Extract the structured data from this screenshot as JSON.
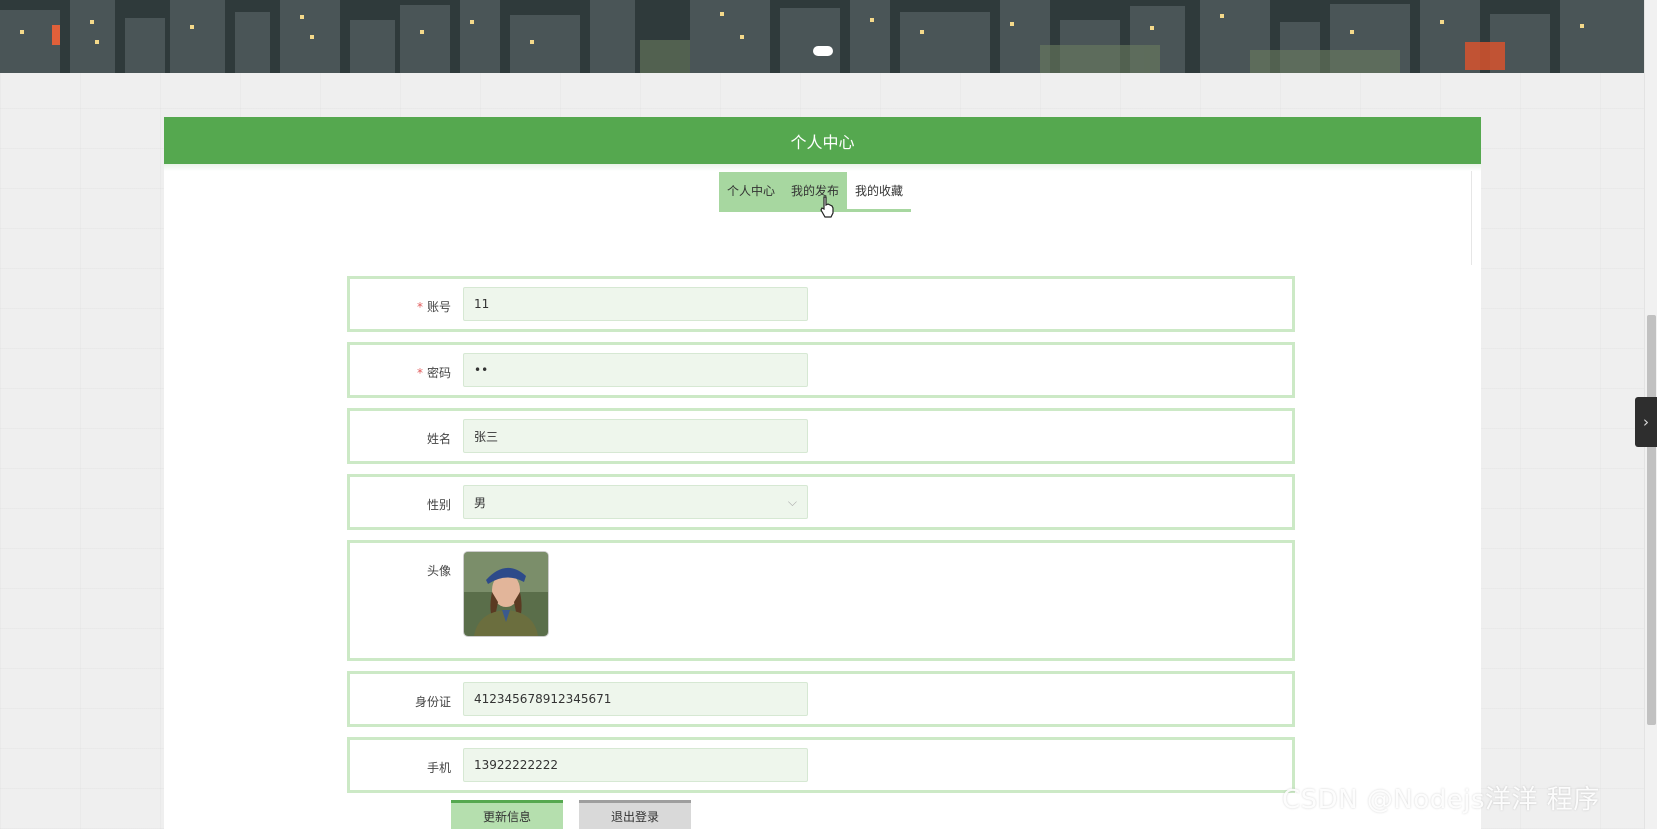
{
  "header": {
    "title": "个人中心"
  },
  "tabs": [
    {
      "label": "个人中心",
      "active": true
    },
    {
      "label": "我的发布",
      "active": false
    },
    {
      "label": "我的收藏",
      "active": false
    }
  ],
  "form": {
    "account": {
      "label": "账号",
      "value": "11",
      "required": true
    },
    "password": {
      "label": "密码",
      "value": "••",
      "required": true
    },
    "name": {
      "label": "姓名",
      "value": "张三"
    },
    "gender": {
      "label": "性别",
      "value": "男"
    },
    "avatar": {
      "label": "头像"
    },
    "id_card": {
      "label": "身份证",
      "value": "412345678912345671"
    },
    "phone": {
      "label": "手机",
      "value": "13922222222"
    }
  },
  "buttons": {
    "update": "更新信息",
    "logout": "退出登录"
  },
  "watermark": "CSDN @Nodejs洋洋 程序",
  "colors": {
    "accent": "#55a84f",
    "tab_bg": "#a7d7a0",
    "row_border": "#cce9c6",
    "input_bg": "#eef6ec"
  }
}
